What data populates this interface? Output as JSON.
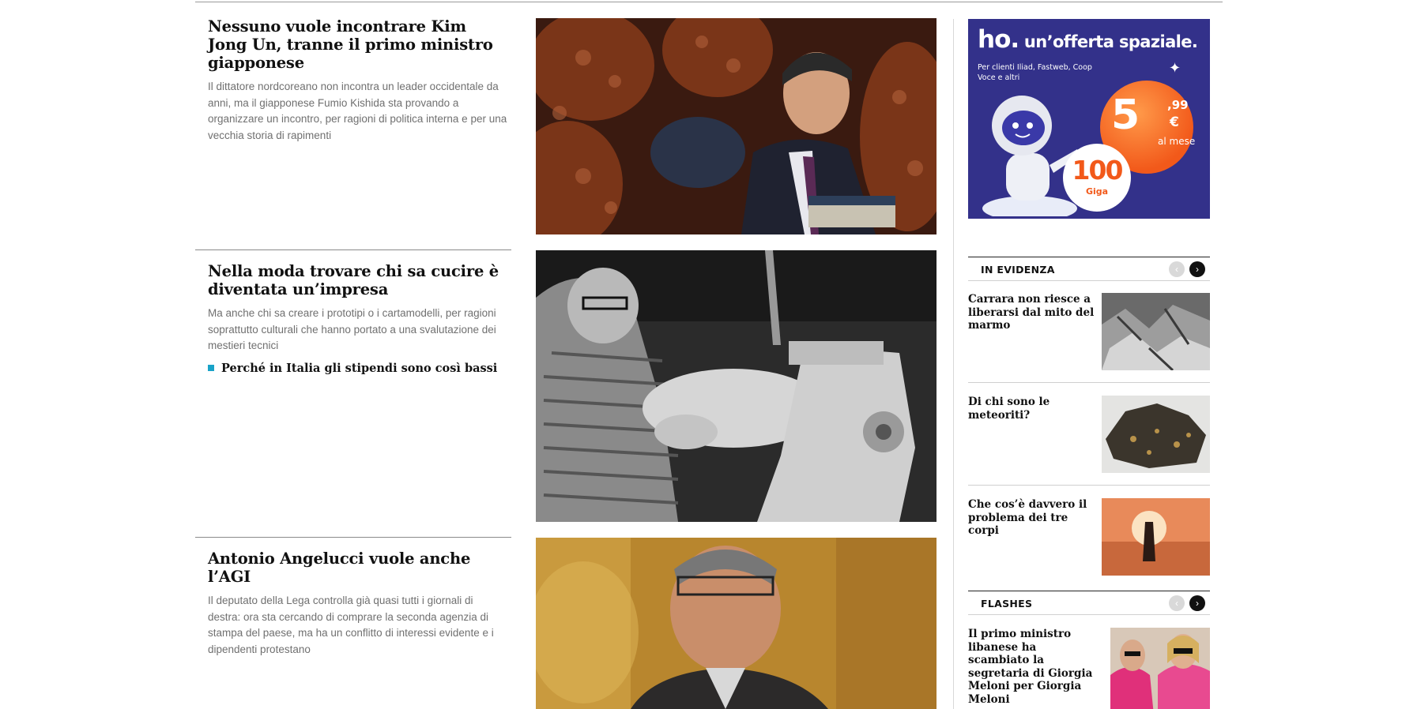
{
  "articles": [
    {
      "title": "Nessuno vuole incontrare Kim Jong Un, tranne il primo ministro giapponese",
      "summary": "Il dittatore nordcoreano non incontra un leader occidentale da anni, ma il giapponese Fumio Kishida sta provando a organizzare un incontro, per ragioni di politica interna e per una vecchia storia di rapimenti"
    },
    {
      "title": "Nella moda trovare chi sa cucire è diventata un’impresa",
      "summary": "Ma anche chi sa creare i prototipi o i cartamodelli, per ragioni soprattutto culturali che hanno portato a una svalutazione dei mestieri tecnici",
      "related": "Perché in Italia gli stipendi sono così bassi"
    },
    {
      "title": "Antonio Angelucci vuole anche l’AGI",
      "summary": "Il deputato della Lega controlla già quasi tutti i giornali di destra: ora sta cercando di comprare la seconda agenzia di stampa del paese, ma ha un conflitto di interessi evidente e i dipendenti protestano"
    }
  ],
  "ad": {
    "brand": "ho.",
    "headline": "un’offerta spaziale.",
    "subtitle": "Per clienti Iliad, Fastweb, Coop Voce e altri",
    "price": "5",
    "cents": ",99",
    "currency": "€",
    "period": "al mese",
    "data_amount": "100",
    "data_unit": "Giga"
  },
  "in_evidenza": {
    "label": "IN EVIDENZA",
    "items": [
      {
        "title": "Carrara non riesce a liberarsi dal mito del marmo"
      },
      {
        "title": "Di chi sono le meteoriti?"
      },
      {
        "title": "Che cos’è davvero il problema dei tre corpi"
      }
    ]
  },
  "flashes": {
    "label": "FLASHES",
    "items": [
      {
        "title": "Il primo ministro libanese ha scambiato la segretaria di Giorgia Meloni per Giorgia Meloni"
      }
    ]
  },
  "icons": {
    "prev": "‹",
    "next": "›"
  },
  "colors": {
    "accent": "#19a3c8",
    "ad_background": "#33318a",
    "ad_orange": "#f2591a"
  }
}
